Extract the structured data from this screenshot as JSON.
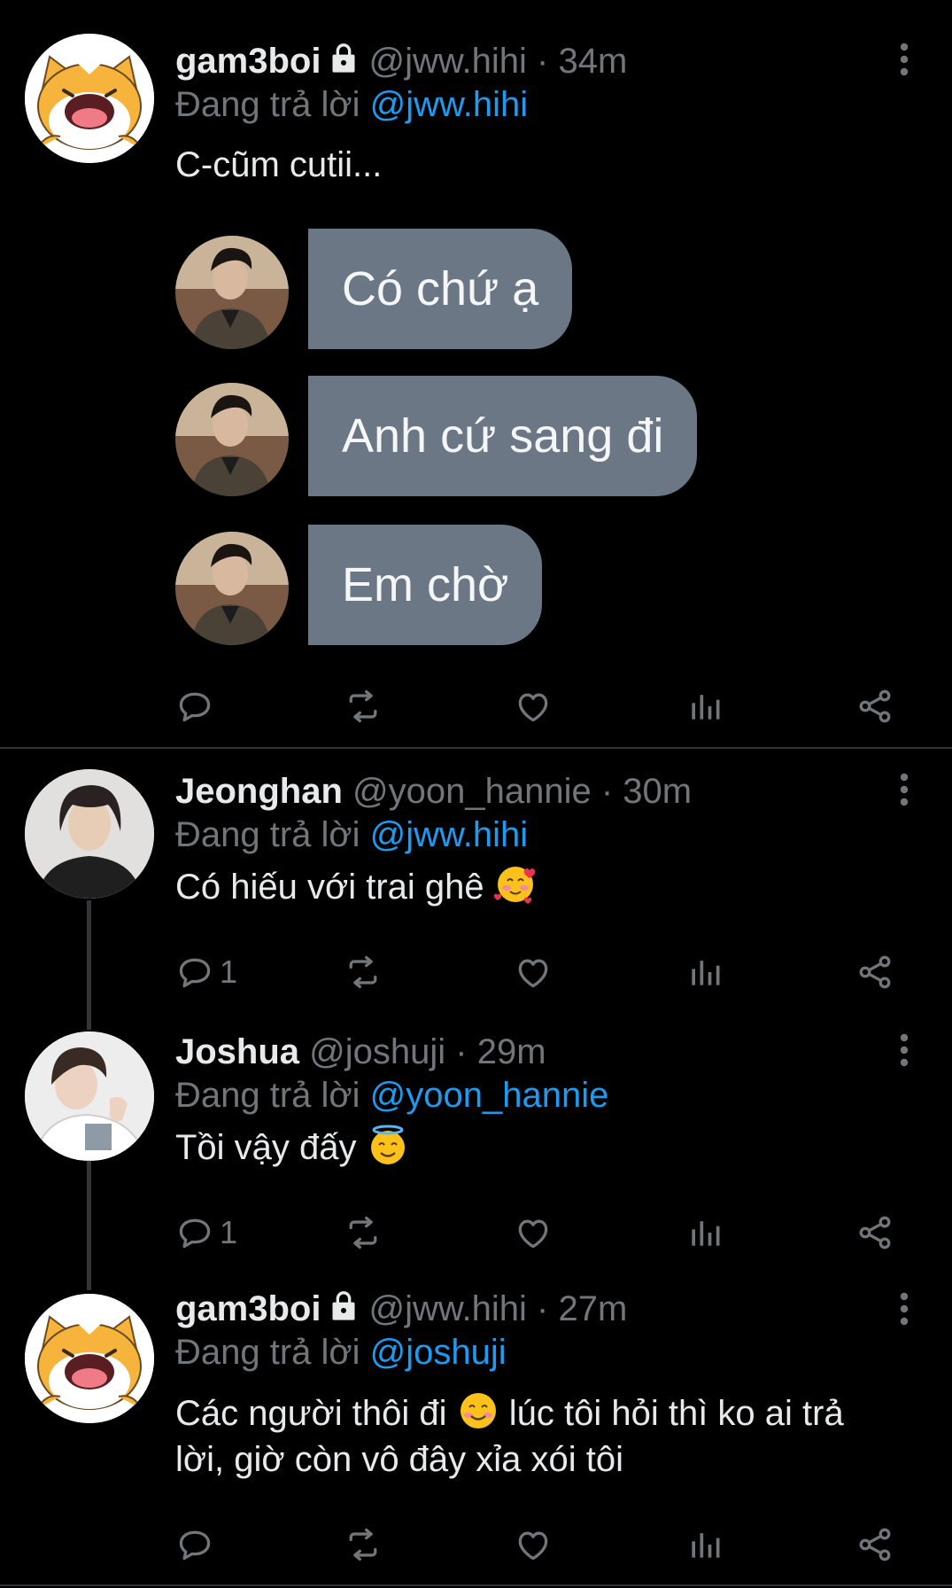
{
  "tweets": [
    {
      "name": "gam3boi",
      "locked": true,
      "handle": "@jww.hihi",
      "time": "34m",
      "replying_prefix": "Đang trả lời ",
      "replying_to": "@jww.hihi",
      "text": "C-cũm cutii...",
      "avatar": "cat-avatar",
      "image": {
        "messages": [
          "Có chứ ạ",
          "Anh cứ sang đi",
          "Em chờ"
        ]
      },
      "reply_count": ""
    },
    {
      "name": "Jeonghan",
      "locked": false,
      "handle": "@yoon_hannie",
      "time": "30m",
      "replying_prefix": "Đang trả lời ",
      "replying_to": "@jww.hihi",
      "text": "Có hiếu với trai ghê",
      "emoji": "smiling-face-with-hearts-emoji",
      "avatar": "person-avatar",
      "reply_count": "1"
    },
    {
      "name": "Joshua",
      "locked": false,
      "handle": "@joshuji",
      "time": "29m",
      "replying_prefix": "Đang trả lời ",
      "replying_to": "@yoon_hannie",
      "text": "Tồi vậy đấy",
      "emoji": "smiling-face-with-halo-emoji",
      "avatar": "person-avatar",
      "reply_count": "1"
    },
    {
      "name": "gam3boi",
      "locked": true,
      "handle": "@jww.hihi",
      "time": "27m",
      "replying_prefix": "Đang trả lời ",
      "replying_to": "@joshuji",
      "text_part1": "Các người thôi đi",
      "emoji": "smiling-face-emoji",
      "text_part2": "lúc tôi hỏi thì ko ai trả",
      "text_line2": "lời, giờ còn vô đây xỉa xói tôi",
      "avatar": "cat-avatar",
      "reply_count": ""
    }
  ],
  "separator": " · ",
  "colors": {
    "background": "#000000",
    "text": "#e7e9ea",
    "muted": "#71767b",
    "link": "#1d9bf0",
    "bubble": "#6b7785"
  }
}
